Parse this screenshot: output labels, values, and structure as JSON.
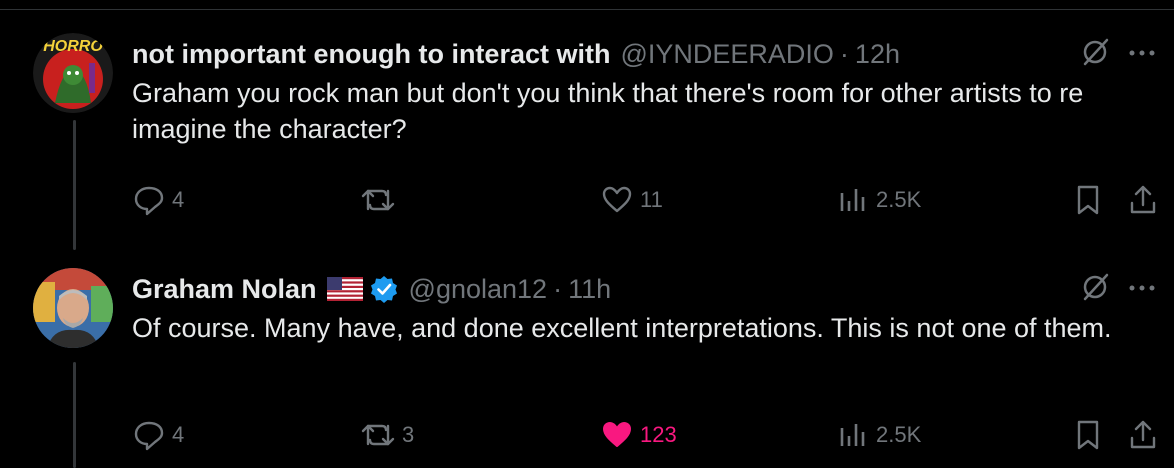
{
  "colors": {
    "background": "#000000",
    "text_primary": "#e7e9ea",
    "text_secondary": "#71767b",
    "like_active": "#f91880",
    "verified_blue": "#1d9bf0",
    "thread_line": "#333639"
  },
  "tweets": [
    {
      "display_name": "not important enough to interact with",
      "handle": "@IYNDEERADIO",
      "separator": "·",
      "time": "12h",
      "avatar_text": "HORRO",
      "text": "Graham you rock man but don't you think that there's room for other artists to re imagine the character?",
      "flag_icon": null,
      "verified": false,
      "actions": {
        "reply": "4",
        "retweet": "",
        "like": "11",
        "like_active": false,
        "views": "2.5K"
      }
    },
    {
      "display_name": "Graham Nolan",
      "handle": "@gnolan12",
      "separator": "·",
      "time": "11h",
      "avatar_text": "",
      "text": "Of course. Many have, and done excellent interpretations. This is not one of them.",
      "flag_icon": "us-flag-icon",
      "verified": true,
      "actions": {
        "reply": "4",
        "retweet": "3",
        "like": "123",
        "like_active": true,
        "views": "2.5K"
      }
    }
  ]
}
